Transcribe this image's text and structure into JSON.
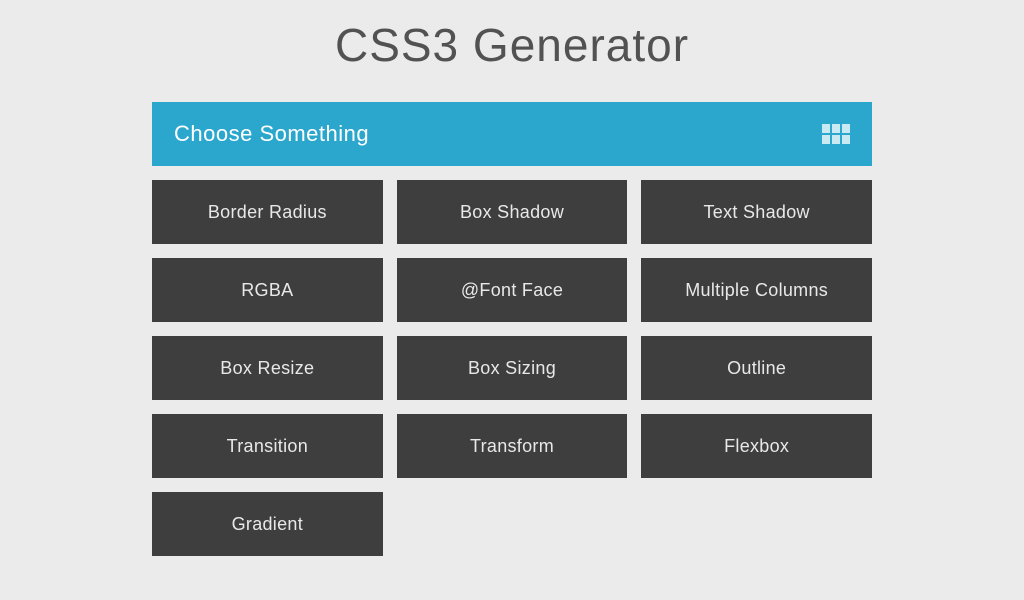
{
  "header": {
    "title": "CSS3 Generator"
  },
  "selector": {
    "label": "Choose Something"
  },
  "options": [
    {
      "label": "Border Radius"
    },
    {
      "label": "Box Shadow"
    },
    {
      "label": "Text Shadow"
    },
    {
      "label": "RGBA"
    },
    {
      "label": "@Font Face"
    },
    {
      "label": "Multiple Columns"
    },
    {
      "label": "Box Resize"
    },
    {
      "label": "Box Sizing"
    },
    {
      "label": "Outline"
    },
    {
      "label": "Transition"
    },
    {
      "label": "Transform"
    },
    {
      "label": "Flexbox"
    },
    {
      "label": "Gradient"
    }
  ],
  "colors": {
    "accent": "#2ba7ce",
    "tile": "#3e3e3e",
    "background": "#ebebeb"
  }
}
